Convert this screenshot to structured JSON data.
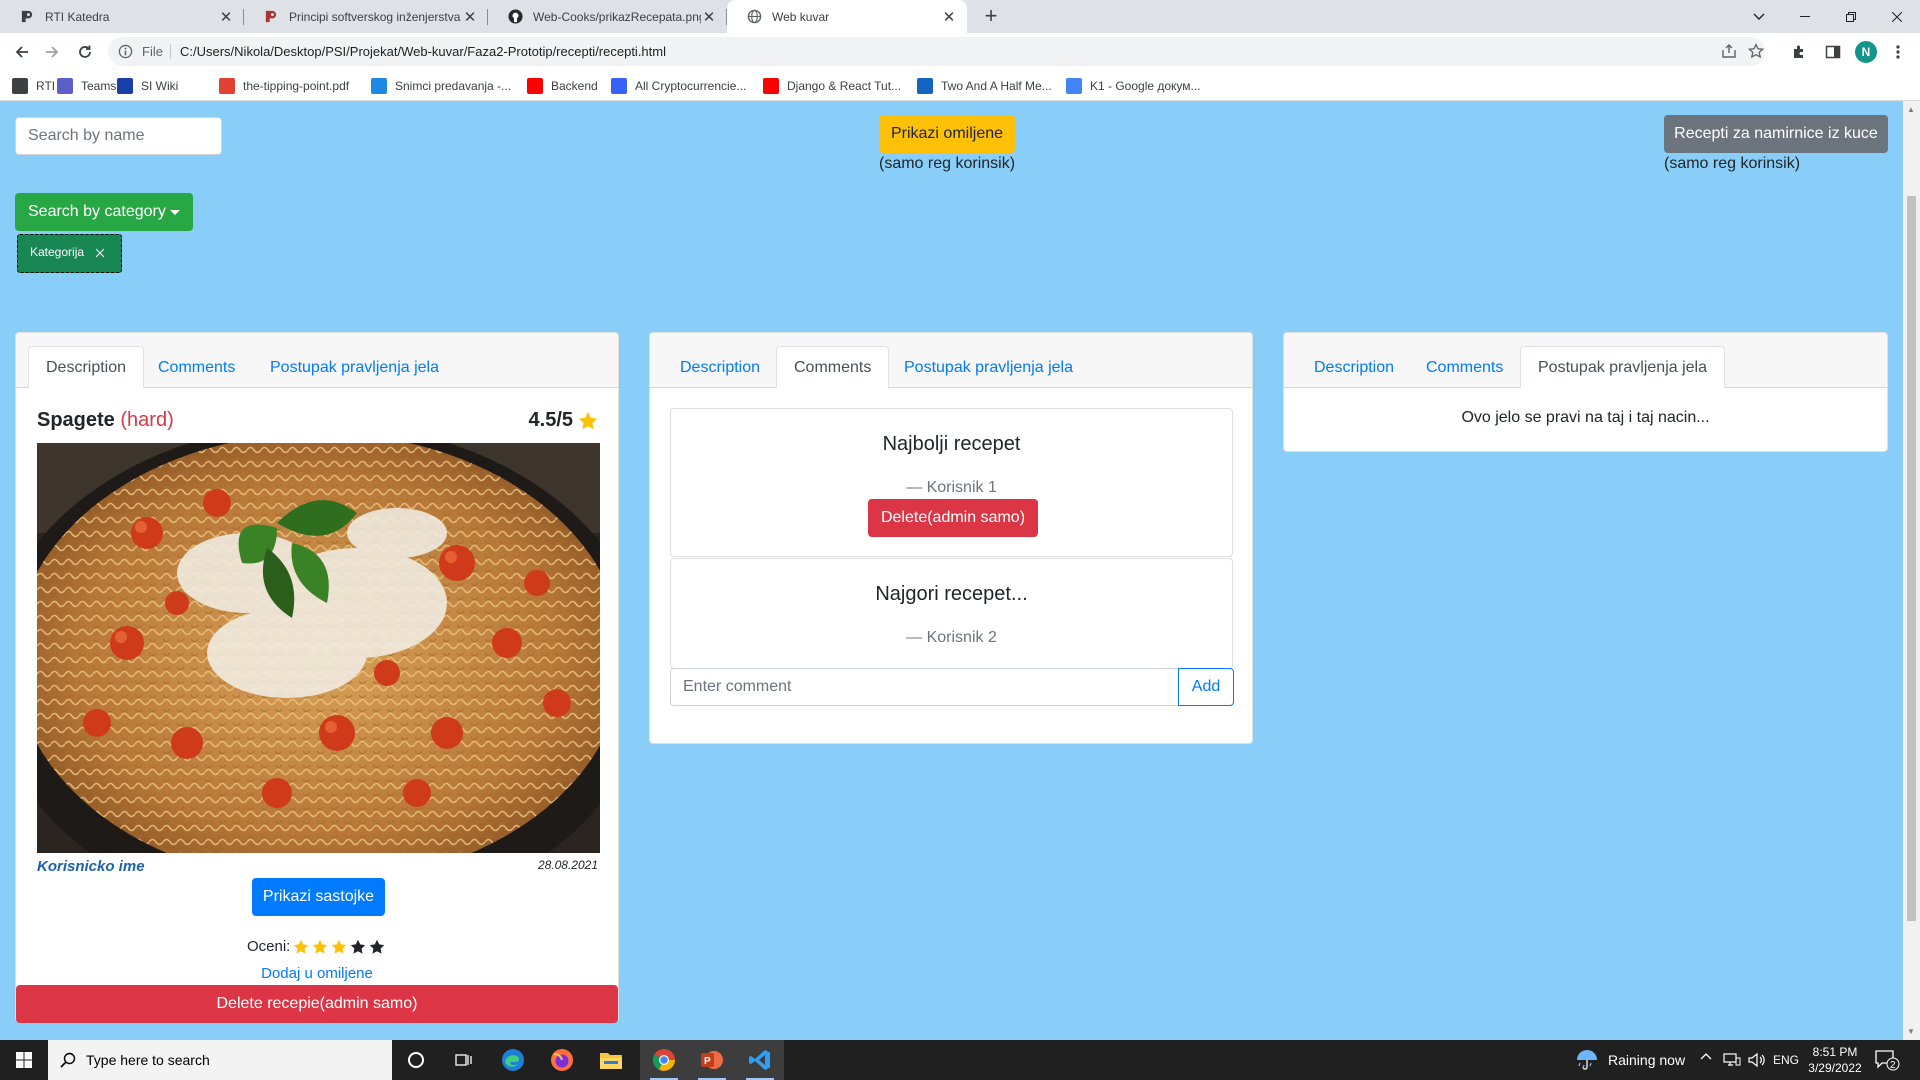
{
  "browser": {
    "tabs": [
      {
        "title": "RTI Katedra",
        "icon": "rti-favicon",
        "active": false
      },
      {
        "title": "Principi softverskog inženjerstva",
        "icon": "pdf-favicon",
        "active": false
      },
      {
        "title": "Web-Cooks/prikazRecepata.png",
        "icon": "github-favicon",
        "active": false
      },
      {
        "title": "Web kuvar",
        "icon": "globe-favicon",
        "active": true
      }
    ],
    "address": {
      "scheme_label": "File",
      "url": "C:/Users/Nikola/Desktop/PSI/Projekat/Web-kuvar/Faza2-Prototip/recepti/recepti.html"
    },
    "profile_initial": "N",
    "bookmarks": [
      {
        "label": "RTI",
        "color": "#3c4043"
      },
      {
        "label": "Teams",
        "color": "#5b5fc7"
      },
      {
        "label": "SI Wiki",
        "color": "#1a3fa8"
      },
      {
        "label": "the-tipping-point.pdf",
        "color": "#e34133"
      },
      {
        "label": "Snimci predavanja -...",
        "color": "#1e88e5"
      },
      {
        "label": "Backend",
        "color": "#ff0000"
      },
      {
        "label": "All Cryptocurrencie...",
        "color": "#3861fb"
      },
      {
        "label": "Django & React Tut...",
        "color": "#ff0000"
      },
      {
        "label": "Two And A Half Me...",
        "color": "#1565c0"
      },
      {
        "label": "K1 - Google докум...",
        "color": "#4285f4"
      }
    ]
  },
  "page": {
    "search_placeholder": "Search by name",
    "favorites_button": "Prikazi omiljene",
    "favorites_note": "(samo reg korinsik)",
    "home_button": "Recepti za namirnice iz kuce",
    "home_note": "(samo reg korinsik)",
    "category_button": "Search by category",
    "category_chip": "Kategorija"
  },
  "card1": {
    "tabs": [
      "Description",
      "Comments",
      "Postupak pravljenja jela"
    ],
    "title": "Spagete",
    "difficulty": "(hard)",
    "rating": "4.5/5",
    "author": "Korisnicko ime",
    "date": "28.08.2021",
    "ingredients_button": "Prikazi sastojke",
    "rate_label": "Oceni:",
    "rate_value": 3,
    "rate_max": 5,
    "add_favorite": "Dodaj u omiljene",
    "delete_button": "Delete recepie(admin samo)"
  },
  "card2": {
    "tabs": [
      "Description",
      "Comments",
      "Postupak pravljenja jela"
    ],
    "comments": [
      {
        "text": "Najbolji recepet",
        "author": "— Korisnik 1"
      },
      {
        "text": "Najgori recepet...",
        "author": "— Korisnik 2"
      }
    ],
    "delete_comment": "Delete(admin samo)",
    "comment_placeholder": "Enter comment",
    "add_button": "Add"
  },
  "card3": {
    "tabs": [
      "Description",
      "Comments",
      "Postupak pravljenja jela"
    ],
    "text": "Ovo jelo se pravi na taj i taj nacin..."
  },
  "taskbar": {
    "search_placeholder": "Type here to search",
    "weather": "Raining now",
    "language": "ENG",
    "time": "8:51 PM",
    "date": "3/29/2022",
    "notifications": "2"
  },
  "colors": {
    "page_bg": "#89cef8",
    "primary": "#007bff",
    "danger": "#dc3545",
    "warning": "#ffc107",
    "success": "#28a745",
    "secondary": "#6c757d"
  }
}
